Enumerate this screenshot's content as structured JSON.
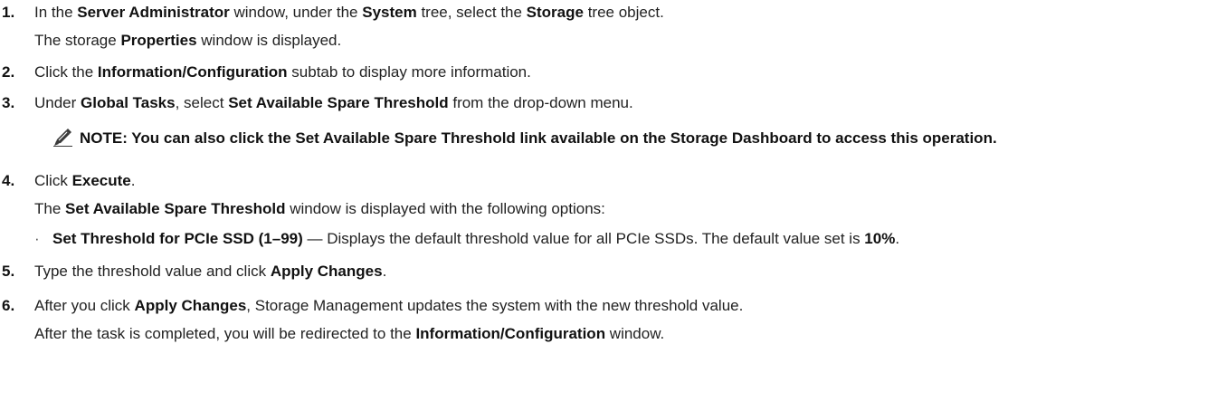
{
  "steps": [
    {
      "number": "1.",
      "lines": [
        [
          "In the ",
          "Server Administrator",
          " window, under the ",
          "System",
          " tree, select the ",
          "Storage",
          " tree object."
        ],
        [
          "The storage ",
          "Properties",
          " window is displayed."
        ]
      ]
    },
    {
      "number": "2.",
      "lines": [
        [
          "Click the ",
          "Information/Configuration",
          " subtab to display more information."
        ]
      ]
    },
    {
      "number": "3.",
      "lines": [
        [
          "Under ",
          "Global Tasks",
          ", select ",
          "Set Available Spare Threshold",
          " from the drop-down menu."
        ]
      ],
      "note": {
        "icon": "pencil-icon",
        "text": "NOTE: You can also click the Set Available Spare Threshold link available on the Storage Dashboard to access this operation."
      }
    },
    {
      "number": "4.",
      "lines": [
        [
          "Click ",
          "Execute",
          "."
        ],
        [
          "The ",
          "Set Available Spare Threshold",
          " window is displayed with the following options:"
        ]
      ],
      "bullet": {
        "symbol": "·",
        "parts": [
          "",
          "Set Threshold for PCIe SSD (1–99)",
          " — Displays the default threshold value for all PCIe SSDs. The default value set is ",
          "10%",
          "."
        ]
      }
    },
    {
      "number": "5.",
      "lines": [
        [
          "Type the threshold value and click ",
          "Apply Changes",
          "."
        ]
      ]
    },
    {
      "number": "6.",
      "lines": [
        [
          "After you click ",
          "Apply Changes",
          ", Storage Management updates the system with the new threshold value."
        ],
        [
          "After the task is completed, you will be redirected to the ",
          "Information/Configuration",
          " window."
        ]
      ]
    }
  ]
}
